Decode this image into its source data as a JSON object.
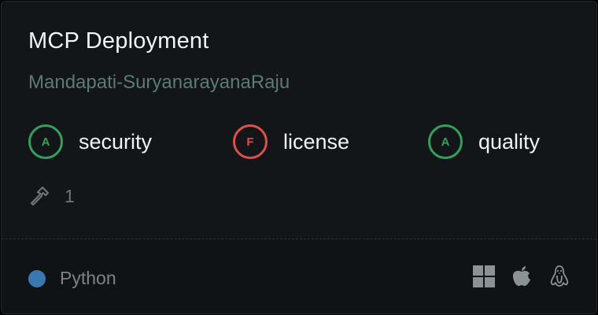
{
  "card": {
    "title": "MCP Deployment",
    "author": "Mandapati-SuryanarayanaRaju"
  },
  "grades": [
    {
      "letter": "A",
      "label": "security",
      "status": "pass",
      "color": "#2fa15d"
    },
    {
      "letter": "F",
      "label": "license",
      "status": "fail",
      "color": "#e14d4d"
    },
    {
      "letter": "A",
      "label": "quality",
      "status": "pass",
      "color": "#2fa15d"
    }
  ],
  "tools": {
    "icon": "hammer-icon",
    "count": "1"
  },
  "footer": {
    "language": "Python",
    "language_color": "#3b77b0",
    "platforms": [
      "windows-icon",
      "apple-icon",
      "linux-icon"
    ]
  }
}
